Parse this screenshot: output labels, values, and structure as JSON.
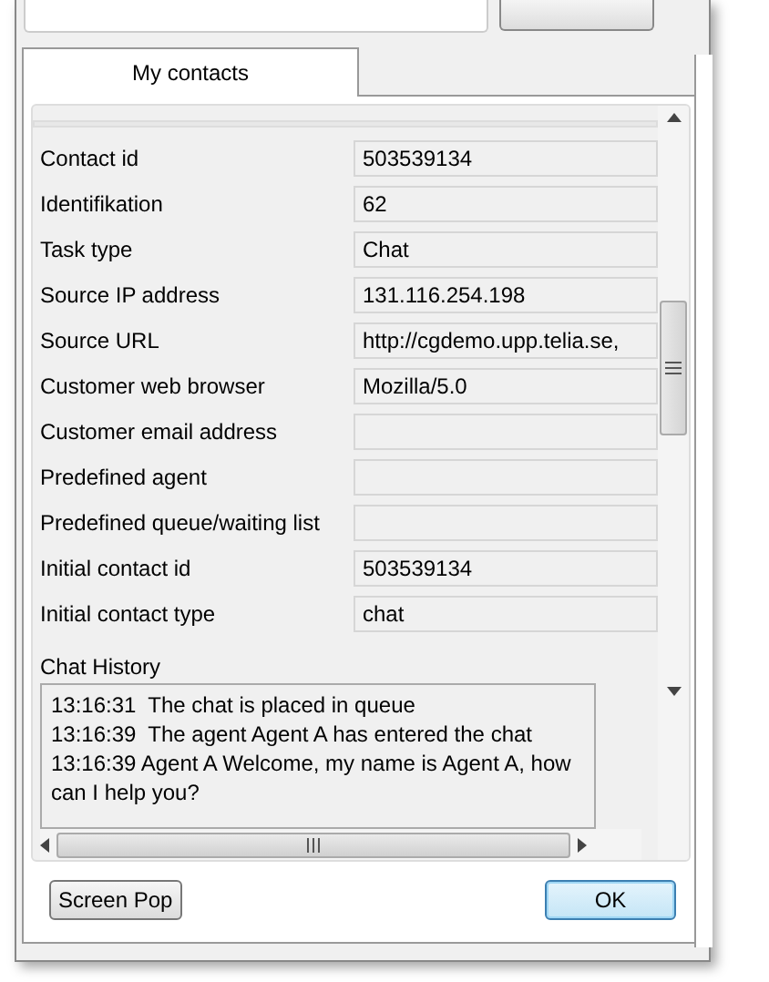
{
  "tabs": [
    {
      "label": "My contacts",
      "selected": true
    }
  ],
  "fields": [
    {
      "label": "Contact id",
      "value": "503539134"
    },
    {
      "label": "Identifikation",
      "value": "62"
    },
    {
      "label": "Task type",
      "value": "Chat"
    },
    {
      "label": "Source IP address",
      "value": "131.116.254.198"
    },
    {
      "label": "Source URL",
      "value": "http://cgdemo.upp.telia.se,"
    },
    {
      "label": "Customer web browser",
      "value": "Mozilla/5.0"
    },
    {
      "label": "Customer email address"
    },
    {
      "label": "Predefined agent"
    },
    {
      "label": "Predefined queue/waiting list"
    },
    {
      "label": "Initial contact id",
      "value": "503539134"
    },
    {
      "label": "Initial contact type",
      "value": "chat"
    }
  ],
  "chat_history": {
    "label": "Chat History",
    "lines": [
      "13:16:31  The chat is placed in queue",
      "13:16:39  The agent Agent A has entered the chat",
      "13:16:39 Agent A Welcome, my name is Agent A, how can I help you?"
    ]
  },
  "buttons": [
    {
      "label": "Screen Pop",
      "kind": "default"
    },
    {
      "label": "OK",
      "kind": "primary"
    }
  ]
}
